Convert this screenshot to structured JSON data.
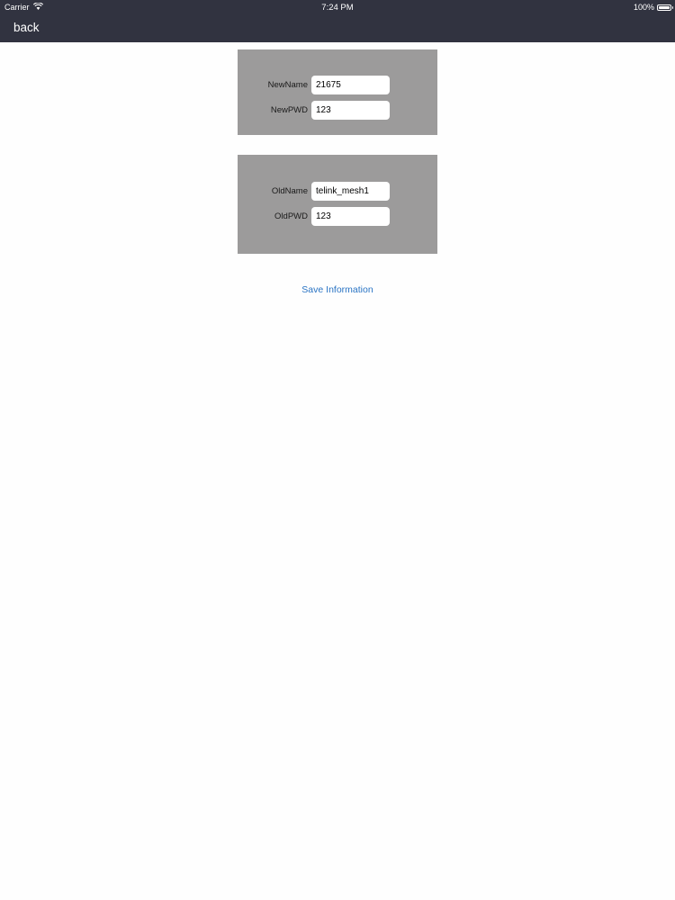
{
  "status_bar": {
    "carrier": "Carrier",
    "time": "7:24 PM",
    "battery": "100%",
    "wifi_icon": "wifi-icon",
    "battery_icon": "battery-icon"
  },
  "nav": {
    "back_label": "back"
  },
  "new_panel": {
    "name_label": "NewName",
    "name_value": "21675",
    "pwd_label": "NewPWD",
    "pwd_value": "123"
  },
  "old_panel": {
    "name_label": "OldName",
    "name_value": "telink_mesh1",
    "pwd_label": "OldPWD",
    "pwd_value": "123"
  },
  "actions": {
    "save_label": "Save Information"
  },
  "colors": {
    "nav_bg": "#313340",
    "panel_bg": "#9c9b9b",
    "link": "#2a74c4",
    "page_bg": "#fefefe"
  }
}
